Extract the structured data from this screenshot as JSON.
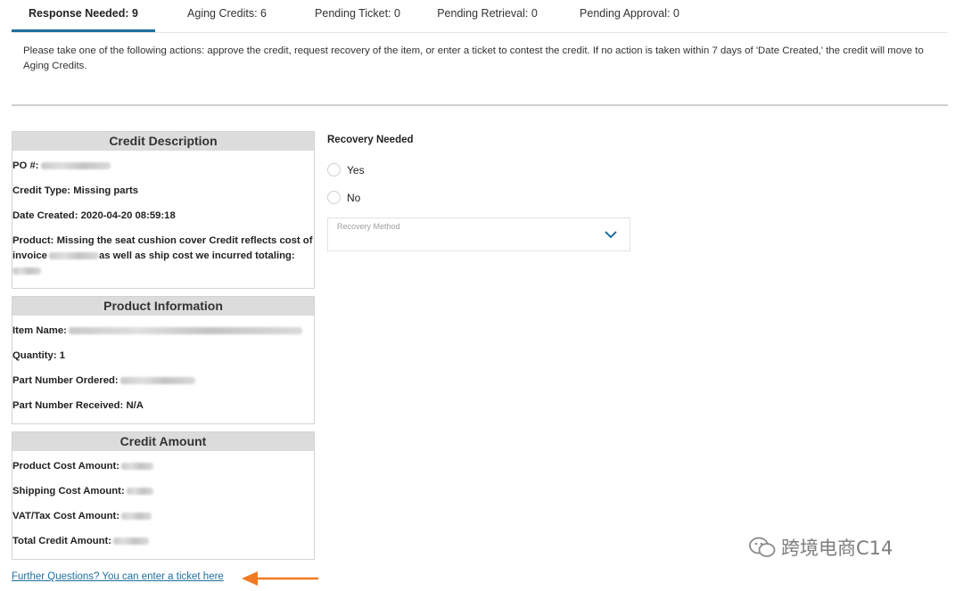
{
  "tabs": [
    {
      "label": "Response Needed: 9",
      "active": true
    },
    {
      "label": "Aging Credits: 6",
      "active": false
    },
    {
      "label": "Pending Ticket: 0",
      "active": false
    },
    {
      "label": "Pending Retrieval: 0",
      "active": false
    },
    {
      "label": "Pending Approval: 0",
      "active": false
    }
  ],
  "notice": "Please take one of the following actions: approve the credit, request recovery of the item, or enter a ticket to contest the credit. If no action is taken within 7 days of 'Date Created,' the credit will move to Aging Credits.",
  "credit_description": {
    "title": "Credit Description",
    "po_label": "PO #:",
    "credit_type": "Credit Type: Missing parts",
    "date_created": "Date Created: 2020-04-20 08:59:18",
    "product_line1": "Product: Missing the seat cushion cover Credit reflects cost of",
    "product_invoice_label": "invoice",
    "product_line2_rest": "as well as ship cost we incurred totaling:"
  },
  "product_information": {
    "title": "Product Information",
    "item_name_label": "Item Name:",
    "quantity": "Quantity: 1",
    "part_ordered_label": "Part Number Ordered:",
    "part_received": "Part Number Received: N/A"
  },
  "credit_amount": {
    "title": "Credit Amount",
    "product_cost_label": "Product Cost Amount:",
    "shipping_cost_label": "Shipping Cost Amount:",
    "vat_label": "VAT/Tax Cost Amount:",
    "total_label": "Total Credit Amount:"
  },
  "further_link": "Further Questions? You can enter a ticket here",
  "recovery": {
    "title": "Recovery Needed",
    "yes": "Yes",
    "no": "No",
    "method_placeholder": "Recovery Method"
  },
  "watermark": "跨境电商C14",
  "colors": {
    "accent": "#1f6f9f",
    "arrow": "#f07a22",
    "header_bg": "#dcdcdc"
  }
}
